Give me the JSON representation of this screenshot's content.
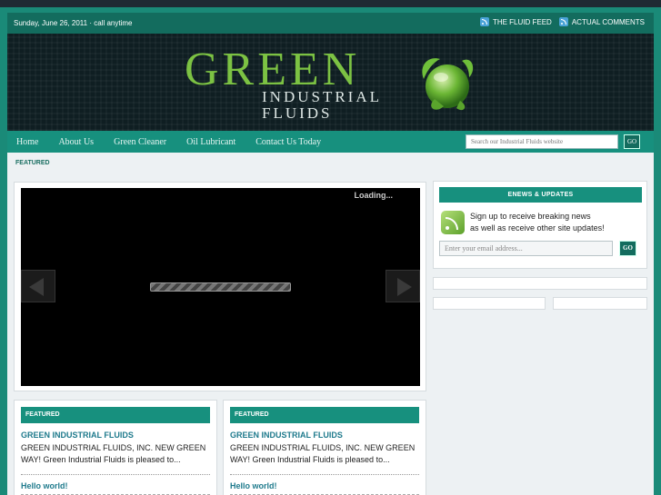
{
  "topbar": {
    "date": "Sunday, June 26, 2011 · call anytime",
    "feeds": [
      "THE FLUID FEED",
      "ACTUAL COMMENTS"
    ]
  },
  "logo": {
    "word": "GREEN",
    "line1": "INDUSTRIAL",
    "line2": "FLUIDS"
  },
  "nav": {
    "items": [
      "Home",
      "About Us",
      "Green Cleaner",
      "Oil Lubricant",
      "Contact Us Today"
    ],
    "search_placeholder": "Search our Industrial Fluids website",
    "search_go": "GO"
  },
  "featured_label": "FEATURED",
  "slider": {
    "loading": "Loading..."
  },
  "enews": {
    "heading": "ENEWS & UPDATES",
    "text_line1": "Sign up to receive breaking news",
    "text_line2": "as well as receive other site updates!",
    "email_placeholder": "Enter your email address...",
    "go": "GO"
  },
  "columns": [
    {
      "heading": "FEATURED",
      "title": "GREEN INDUSTRIAL FLUIDS",
      "text": "GREEN INDUSTRIAL FLUIDS, INC. NEW GREEN WAY! Green Industrial Fluids is pleased to...",
      "hello": "Hello world!"
    },
    {
      "heading": "FEATURED",
      "title": "GREEN INDUSTRIAL FLUIDS",
      "text": "GREEN INDUSTRIAL FLUIDS, INC. NEW GREEN WAY! Green Industrial Fluids is pleased to...",
      "hello": "Hello world!"
    }
  ],
  "colors": {
    "teal": "#17907e",
    "dark_teal": "#136c5e",
    "logo_green": "#7cc243",
    "link_blue": "#1e7a8c"
  },
  "icons": [
    "rss-icon",
    "globe-leaf-icon",
    "arrow-left-icon",
    "arrow-right-icon"
  ]
}
